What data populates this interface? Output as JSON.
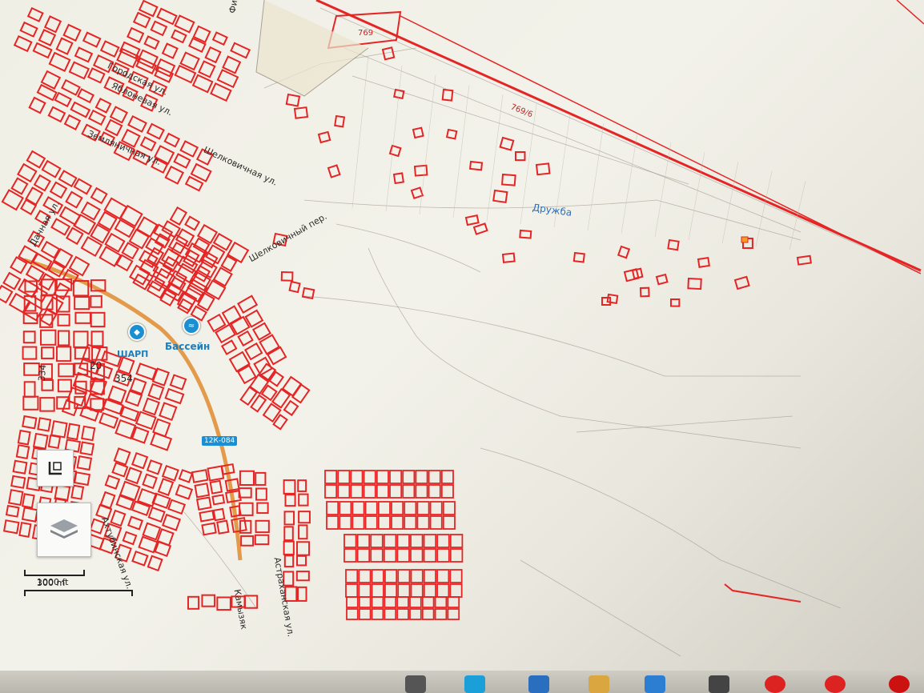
{
  "map": {
    "labels": {
      "street_1": "Земляничная ул.",
      "street_2": "Шелковичная ул.",
      "street_3": "Фиалковая ул.",
      "street_4": "Яблоневая ул.",
      "street_5": "Городская ул.",
      "lane": "Шелковичный пер.",
      "cooperative": "Дружба",
      "parcel_769": "769",
      "parcel_769_6": "769/6",
      "parcel_20": "20",
      "parcel_354": "354",
      "parcel_334": "334",
      "street_kamyzyak": "Камызяк",
      "street_astrakhanskaya": "Астраханская ул.",
      "street_left": "Дачная ул.",
      "street_bottom": "Ахтубинская ул."
    },
    "pois": {
      "pool_label": "Бассейн",
      "pool_icon": "pool-icon",
      "shop_label": "ШАРП",
      "shop_icon": "shop-icon"
    },
    "road_badge": "12К-084"
  },
  "scale": {
    "metric": "300 m",
    "imperial": "1000 ft"
  },
  "controls": {
    "fullscreen_icon": "fullscreen-icon",
    "layers_icon": "layers-icon"
  },
  "colors": {
    "parcel": "#e52525",
    "road": "#e39a4a",
    "poi": "#1a8fd1"
  }
}
